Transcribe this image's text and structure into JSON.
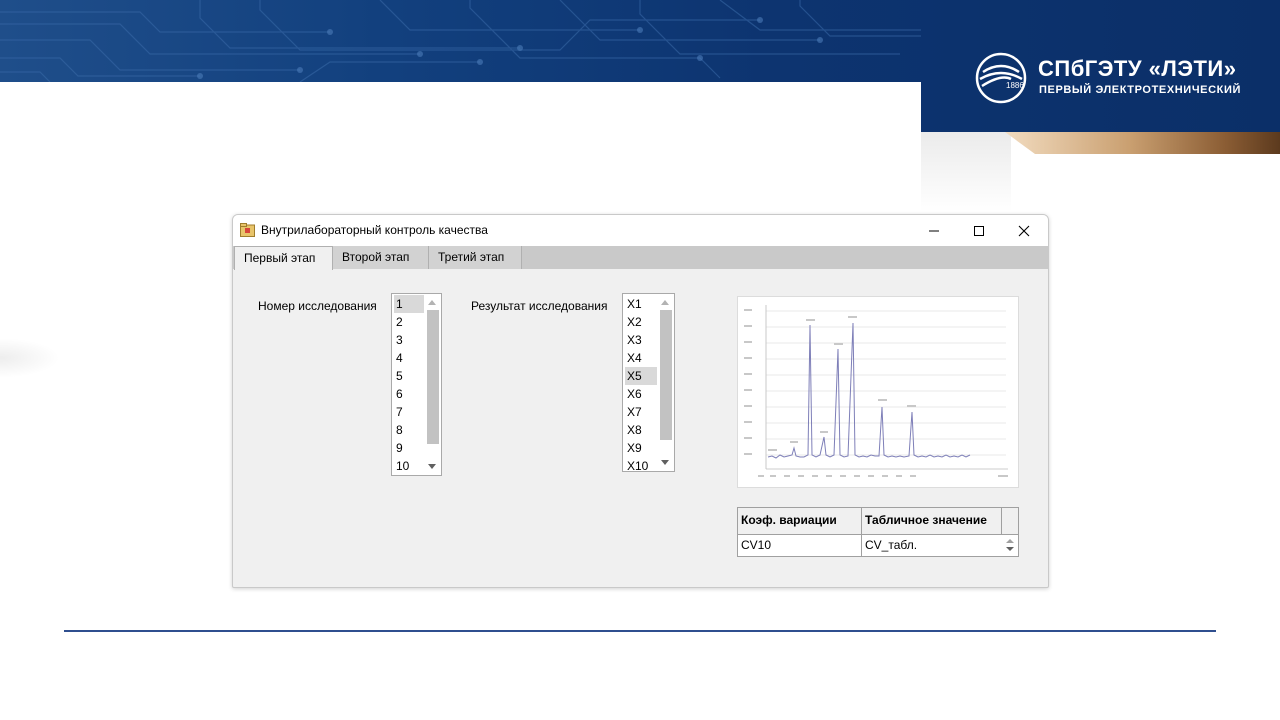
{
  "university": {
    "emblem_year": "1886",
    "name": "СПбГЭТУ «ЛЭТИ»",
    "subtitle": "ПЕРВЫЙ ЭЛЕКТРОТЕХНИЧЕСКИЙ"
  },
  "window": {
    "title": "Внутрилабораторный контроль качества",
    "icon": "folder-app-icon",
    "controls": [
      "minimize-icon",
      "maximize-icon",
      "close-icon"
    ]
  },
  "tabs": [
    {
      "label": "Первый этап",
      "active": true
    },
    {
      "label": "Второй этап",
      "active": false
    },
    {
      "label": "Третий этап",
      "active": false
    }
  ],
  "study_number": {
    "label": "Номер исследования",
    "items": [
      "1",
      "2",
      "3",
      "4",
      "5",
      "6",
      "7",
      "8",
      "9",
      "10"
    ],
    "selected": "1"
  },
  "study_result": {
    "label": "Результат исследования",
    "items": [
      "X1",
      "X2",
      "X3",
      "X4",
      "X5",
      "X6",
      "X7",
      "X8",
      "X9",
      "X10"
    ],
    "selected": "X5"
  },
  "grid": {
    "columns": [
      "Коэф. вариации",
      "Табличное значение"
    ],
    "rows": [
      [
        "CV10",
        "CV_табл."
      ]
    ]
  },
  "colors": {
    "banner": "#0d3470",
    "accent_gold": "#caa071",
    "divider": "#2f4f8f",
    "chart_line": "#7e7fb8"
  }
}
